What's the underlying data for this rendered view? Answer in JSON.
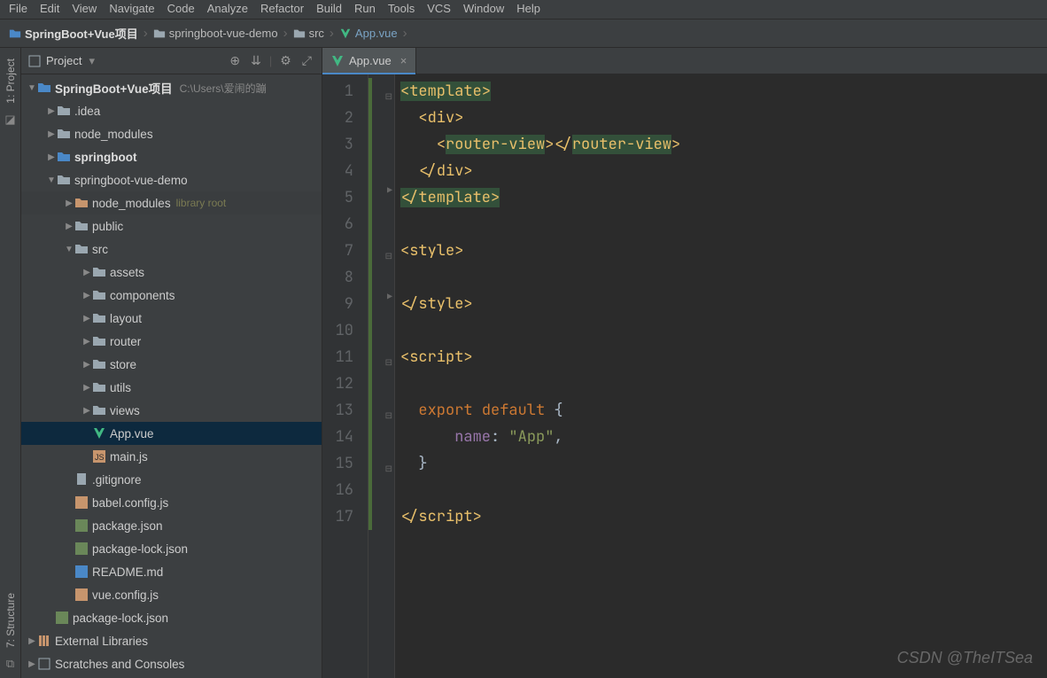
{
  "menubar": [
    "File",
    "Edit",
    "View",
    "Navigate",
    "Code",
    "Analyze",
    "Refactor",
    "Build",
    "Run",
    "Tools",
    "VCS",
    "Window",
    "Help"
  ],
  "breadcrumb": {
    "project": "SpringBoot+Vue项目",
    "module": "springboot-vue-demo",
    "folder": "src",
    "file": "App.vue"
  },
  "panel": {
    "title": "Project"
  },
  "tree": {
    "root": "SpringBoot+Vue项目",
    "root_path": "C:\\Users\\爱闹的蹦",
    "idea": ".idea",
    "node_modules": "node_modules",
    "springboot": "springboot",
    "svd": "springboot-vue-demo",
    "svd_nm": "node_modules",
    "svd_nm_tag": "library root",
    "public": "public",
    "src": "src",
    "assets": "assets",
    "components": "components",
    "layout": "layout",
    "router": "router",
    "store": "store",
    "utils": "utils",
    "views": "views",
    "appvue": "App.vue",
    "mainjs": "main.js",
    "gitignore": ".gitignore",
    "babel": "babel.config.js",
    "pkgjson": "package.json",
    "pkglock": "package-lock.json",
    "readme": "README.md",
    "vuecfg": "vue.config.js",
    "pkglock2": "package-lock.json",
    "extlib": "External Libraries",
    "scratches": "Scratches and Consoles"
  },
  "leftbar": {
    "project": "1: Project",
    "structure": "7: Structure"
  },
  "tab": {
    "label": "App.vue"
  },
  "code": {
    "lines": [
      "1",
      "2",
      "3",
      "4",
      "5",
      "6",
      "7",
      "8",
      "9",
      "10",
      "11",
      "12",
      "13",
      "14",
      "15",
      "16",
      "17"
    ],
    "template_open": "template",
    "div": "div",
    "routerview": "router-view",
    "template_close": "template",
    "style": "style",
    "script": "script",
    "export": "export ",
    "default": "default ",
    "name": "name",
    "app_str": "\"App\""
  },
  "watermark": "CSDN @TheITSea"
}
